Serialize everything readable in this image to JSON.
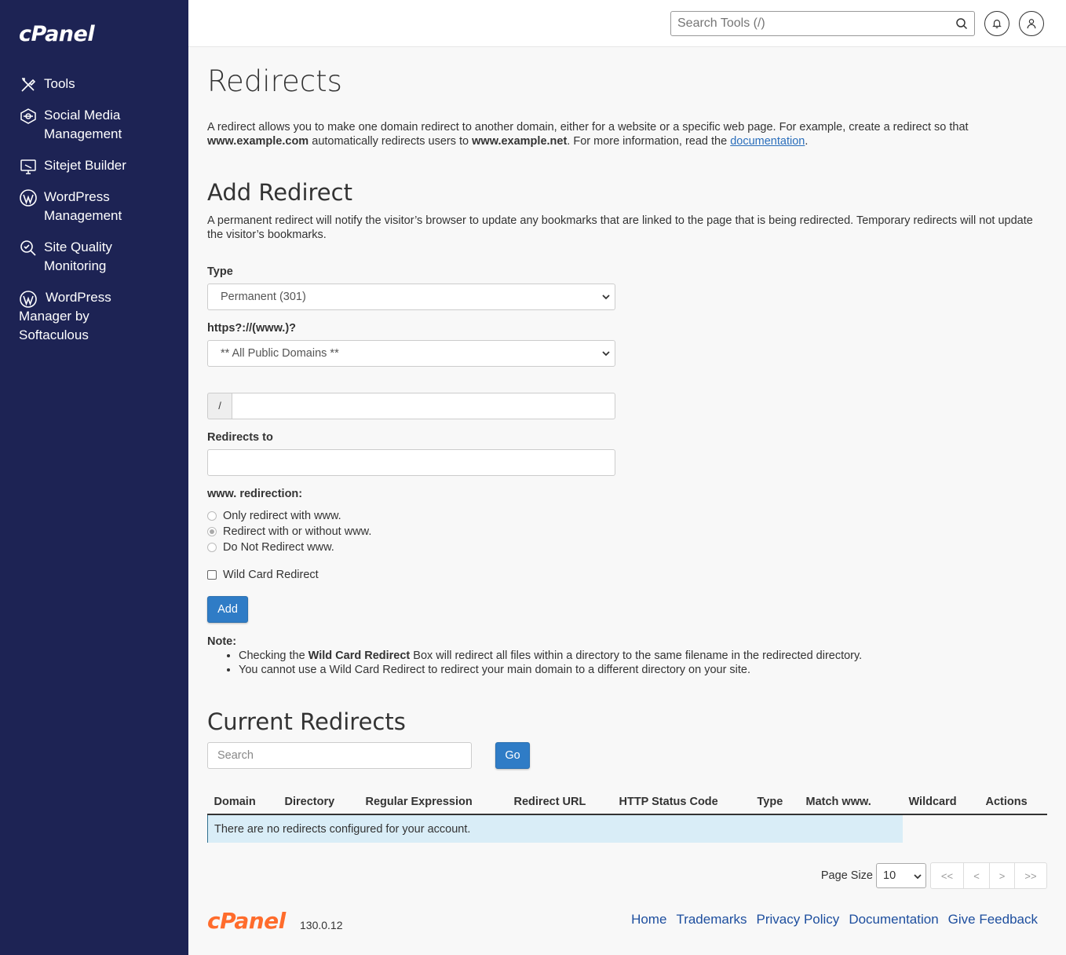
{
  "sidebar": {
    "logo": "cPanel",
    "items": [
      {
        "label": "Tools"
      },
      {
        "label": "Social Media Management"
      },
      {
        "label": "Sitejet Builder"
      },
      {
        "label": "WordPress Management"
      },
      {
        "label": "Site Quality Monitoring"
      },
      {
        "label": "WordPress Manager by Softaculous"
      }
    ]
  },
  "topbar": {
    "search_placeholder": "Search Tools (/)"
  },
  "page": {
    "title": "Redirects",
    "intro": {
      "part1": "A redirect allows you to make one domain redirect to another domain, either for a website or a specific web page. For example, create a redirect so that",
      "ex1": "www.example.com",
      "part2": "automatically redirects users to",
      "ex2": "www.example.net",
      "part3": ". For more information, read the",
      "link": "documentation",
      "part4": "."
    }
  },
  "add_redirect": {
    "title": "Add Redirect",
    "description": "A permanent redirect will notify the visitor’s browser to update any bookmarks that are linked to the page that is being redirected. Temporary redirects will not update the visitor’s bookmarks.",
    "type_label": "Type",
    "type_value": "Permanent (301)",
    "domain_label": "https?://(www.)?",
    "domain_value": "** All Public Domains **",
    "path_prefix": "/",
    "path_value": "",
    "redirects_to_label": "Redirects to",
    "redirects_to_value": "",
    "www_label": "www. redirection:",
    "www_options": [
      {
        "label": "Only redirect with www.",
        "checked": false
      },
      {
        "label": "Redirect with or without www.",
        "checked": true
      },
      {
        "label": "Do Not Redirect www.",
        "checked": false
      }
    ],
    "wildcard_label": "Wild Card Redirect",
    "add_button": "Add",
    "note_heading": "Note:",
    "note1_pre": "Checking the",
    "note1_bold": "Wild Card Redirect",
    "note1_post": "Box will redirect all files within a directory to the same filename in the redirected directory.",
    "note2": "You cannot use a Wild Card Redirect to redirect your main domain to a different directory on your site."
  },
  "current_redirects": {
    "title": "Current Redirects",
    "search_placeholder": "Search",
    "go_button": "Go",
    "columns": [
      "Domain",
      "Directory",
      "Regular Expression",
      "Redirect URL",
      "HTTP Status Code",
      "Type",
      "Match www.",
      "Wildcard",
      "Actions"
    ],
    "empty_message": "There are no redirects configured for your account.",
    "page_size_label": "Page Size",
    "page_size_value": "10",
    "pager": [
      "<<",
      "<",
      ">",
      ">>"
    ]
  },
  "footer": {
    "logo": "cPanel",
    "version": "130.0.12",
    "links": [
      "Home",
      "Trademarks",
      "Privacy Policy",
      "Documentation",
      "Give Feedback"
    ]
  },
  "colors": {
    "sidebar_bg": "#1d2354",
    "primary": "#2f7cc6",
    "brand_orange": "#ff6c2c",
    "link": "#1d4e9e",
    "info_bg": "#d9edf7"
  }
}
